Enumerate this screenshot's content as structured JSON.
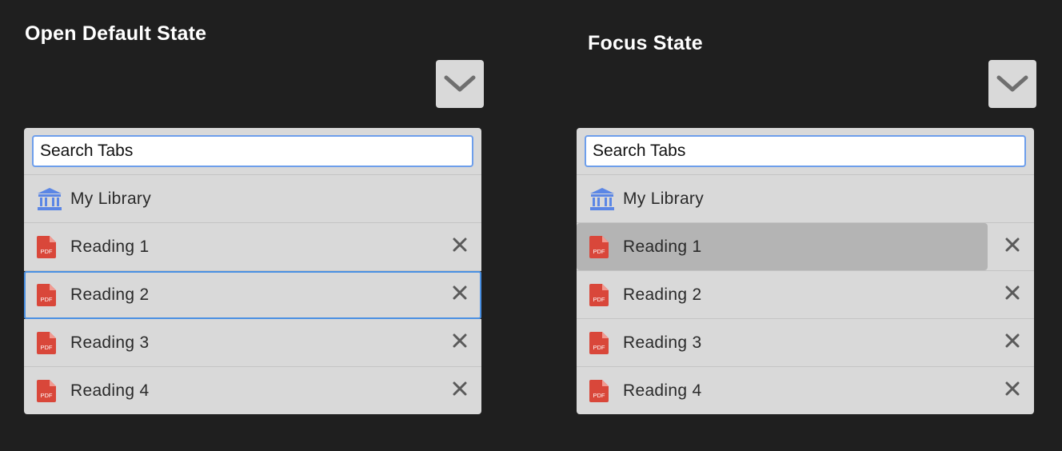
{
  "colors": {
    "background": "#1f1f1f",
    "panel": "#d9d9d9",
    "focus_highlight": "#b4b4b4",
    "accent_blue": "#4a90e2",
    "library_icon": "#5b86e5",
    "pdf_icon": "#d9473a"
  },
  "panels": [
    {
      "title": "Open Default State",
      "toggle_icon": "chevron-down-icon",
      "search": {
        "placeholder": "Search Tabs"
      },
      "library": {
        "label": "My Library",
        "icon": "library-icon"
      },
      "tabs": [
        {
          "label": "Reading 1",
          "icon": "pdf-icon",
          "close_icon": "close-icon",
          "selected": false
        },
        {
          "label": "Reading 2",
          "icon": "pdf-icon",
          "close_icon": "close-icon",
          "selected": true
        },
        {
          "label": "Reading 3",
          "icon": "pdf-icon",
          "close_icon": "close-icon",
          "selected": false
        },
        {
          "label": "Reading 4",
          "icon": "pdf-icon",
          "close_icon": "close-icon",
          "selected": false
        }
      ]
    },
    {
      "title": "Focus State",
      "toggle_icon": "chevron-down-icon",
      "search": {
        "placeholder": "Search Tabs"
      },
      "library": {
        "label": "My Library",
        "icon": "library-icon"
      },
      "tabs": [
        {
          "label": "Reading 1",
          "icon": "pdf-icon",
          "close_icon": "close-icon",
          "focused": true
        },
        {
          "label": "Reading 2",
          "icon": "pdf-icon",
          "close_icon": "close-icon",
          "focused": false
        },
        {
          "label": "Reading 3",
          "icon": "pdf-icon",
          "close_icon": "close-icon",
          "focused": false
        },
        {
          "label": "Reading 4",
          "icon": "pdf-icon",
          "close_icon": "close-icon",
          "focused": false
        }
      ]
    }
  ]
}
